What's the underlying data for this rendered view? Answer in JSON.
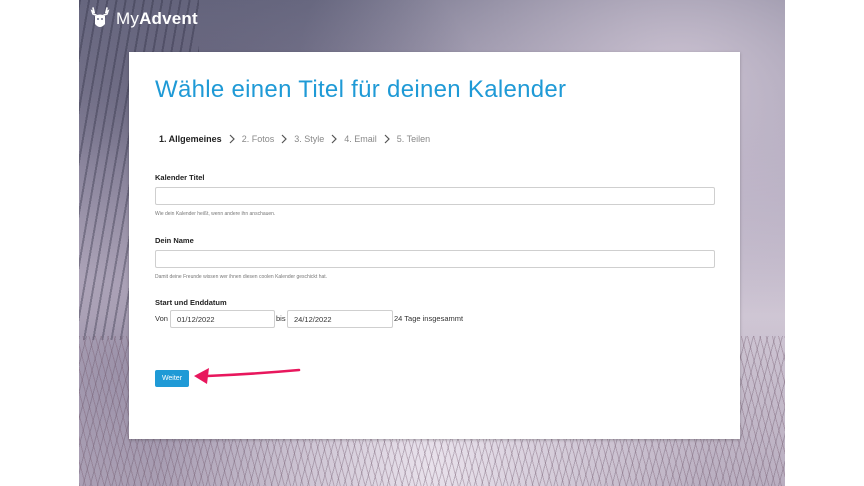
{
  "brand": {
    "name_prefix": "My",
    "name_bold": "Advent",
    "logo_icon": "reindeer-icon"
  },
  "page": {
    "title": "Wähle einen Titel für deinen Kalender"
  },
  "steps": [
    {
      "label": "1. Allgemeines",
      "active": true
    },
    {
      "label": "2. Fotos",
      "active": false
    },
    {
      "label": "3. Style",
      "active": false
    },
    {
      "label": "4. Email",
      "active": false
    },
    {
      "label": "5. Teilen",
      "active": false
    }
  ],
  "form": {
    "calendar_title": {
      "label": "Kalender Titel",
      "value": "",
      "help": "Wie dein Kalender heißt, wenn andere ihn anschauen."
    },
    "name": {
      "label": "Dein Name",
      "value": "",
      "help": "Damit deine Freunde wissen wer ihnen diesen coolen Kalender geschickt hat."
    },
    "dates": {
      "label": "Start und Enddatum",
      "from_label": "Von",
      "from_value": "01/12/2022",
      "to_label": "bis",
      "to_value": "24/12/2022",
      "total": "24 Tage insgesammt"
    }
  },
  "actions": {
    "next_label": "Weiter"
  },
  "colors": {
    "accent": "#1f9ad6",
    "annotation_arrow": "#e8175d"
  }
}
